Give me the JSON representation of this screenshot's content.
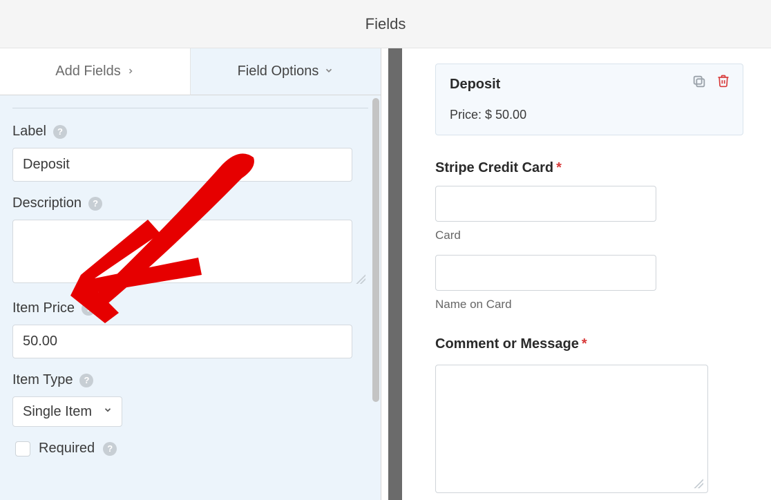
{
  "header": {
    "title": "Fields"
  },
  "tabs": {
    "add_fields": "Add Fields",
    "field_options": "Field Options"
  },
  "left_panel": {
    "label_label": "Label",
    "label_value": "Deposit",
    "description_label": "Description",
    "description_value": "",
    "item_price_label": "Item Price",
    "item_price_value": "50.00",
    "item_type_label": "Item Type",
    "item_type_value": "Single Item",
    "required_label": "Required"
  },
  "preview": {
    "card_title": "Deposit",
    "card_price_prefix": "Price: $ ",
    "card_price_value": "50.00",
    "stripe_label": "Stripe Credit Card",
    "card_sublabel": "Card",
    "name_sublabel": "Name on Card",
    "comment_label": "Comment or Message"
  },
  "icons": {
    "help": "?"
  }
}
